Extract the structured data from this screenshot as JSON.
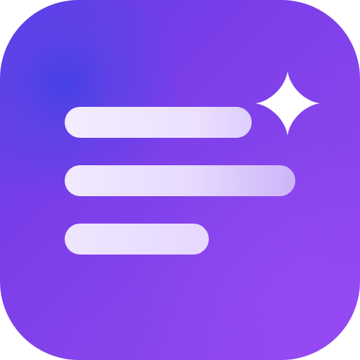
{
  "icon": {
    "style": "rounded-square",
    "accent_colors": {
      "background_start": "#4a43e6",
      "background_mid": "#7b3ee9",
      "background_end": "#9448f1",
      "line_fill": "#f3ecff",
      "sparkle_fill": "#ffffff"
    },
    "items": [
      {
        "name": "text-line-icon"
      },
      {
        "name": "text-line-icon"
      },
      {
        "name": "text-line-icon"
      }
    ],
    "sparkle": {
      "name": "sparkle-icon"
    }
  }
}
